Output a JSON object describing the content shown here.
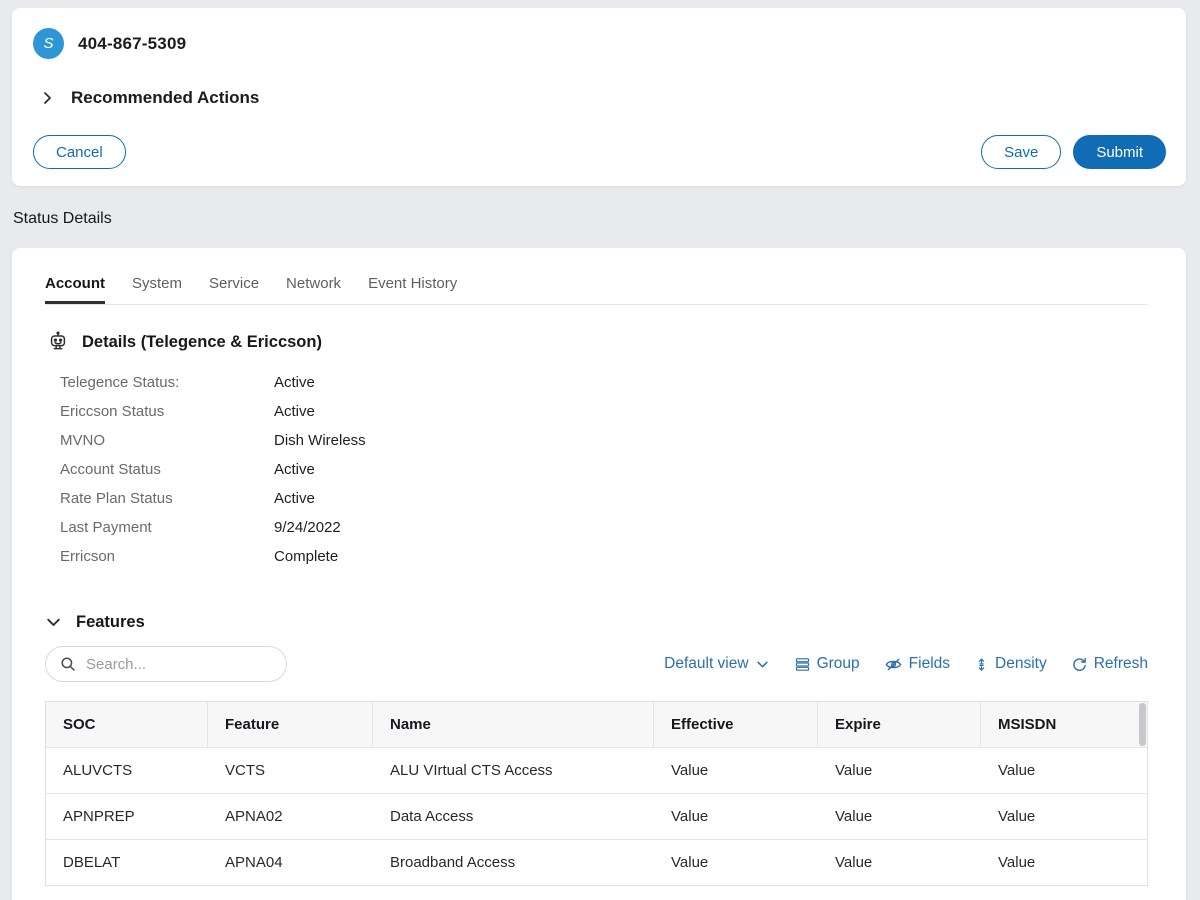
{
  "colors": {
    "accent_blue": "#0f6cb5",
    "avatar_blue": "#2e96d4",
    "toolbar_blue": "#2c6fad",
    "page_bg": "#e9eaed"
  },
  "header_card": {
    "avatar_initial": "S",
    "phone_number": "404-867-5309",
    "recommended_actions_label": "Recommended Actions",
    "cancel_label": "Cancel",
    "save_label": "Save",
    "submit_label": "Submit"
  },
  "status_details": {
    "title": "Status Details",
    "tabs": [
      {
        "label": "Account"
      },
      {
        "label": "System"
      },
      {
        "label": "Service"
      },
      {
        "label": "Network"
      },
      {
        "label": "Event History"
      }
    ],
    "details": {
      "heading": "Details (Telegence & Ericcson)",
      "fields": [
        {
          "label": "Telegence Status:",
          "value": "Active"
        },
        {
          "label": "Ericcson Status",
          "value": "Active"
        },
        {
          "label": "MVNO",
          "value": "Dish Wireless"
        },
        {
          "label": "Account Status",
          "value": "Active"
        },
        {
          "label": "Rate Plan Status",
          "value": "Active"
        },
        {
          "label": "Last Payment",
          "value": "9/24/2022"
        },
        {
          "label": "Erricson",
          "value": "Complete"
        }
      ]
    },
    "features": {
      "heading": "Features",
      "search_placeholder": "Search...",
      "toolbar": {
        "default_view_label": "Default view",
        "group_label": "Group",
        "fields_label": "Fields",
        "density_label": "Density",
        "refresh_label": "Refresh"
      },
      "table": {
        "columns": [
          "SOC",
          "Feature",
          "Name",
          "Effective",
          "Expire",
          "MSISDN"
        ],
        "rows": [
          [
            "ALUVCTS",
            "VCTS",
            "ALU VIrtual CTS Access",
            "Value",
            "Value",
            "Value"
          ],
          [
            "APNPREP",
            "APNA02",
            "Data Access",
            "Value",
            "Value",
            "Value"
          ],
          [
            "DBELAT",
            "APNA04",
            "Broadband Access",
            "Value",
            "Value",
            "Value"
          ]
        ]
      }
    }
  }
}
